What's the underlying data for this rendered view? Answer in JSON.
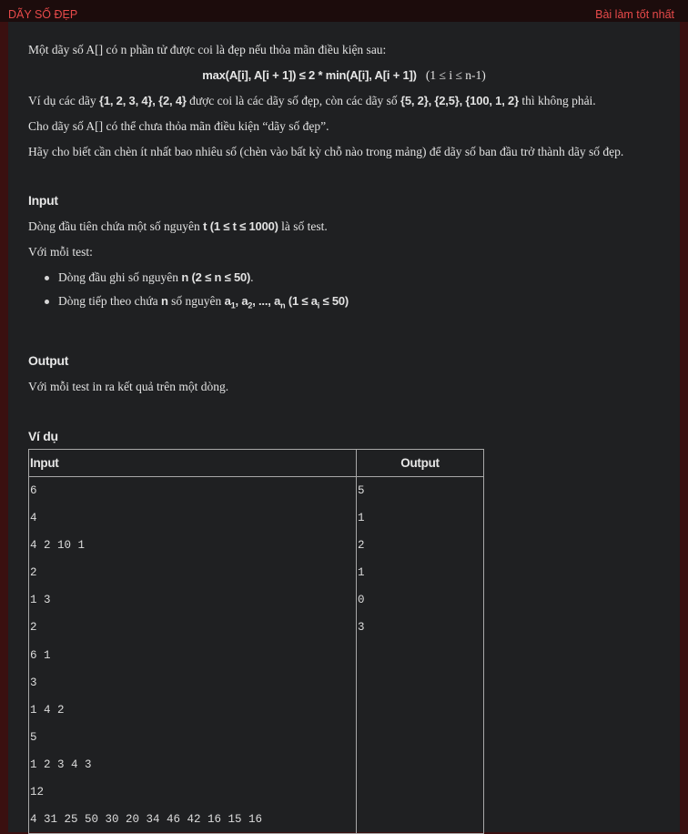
{
  "header": {
    "title": "DÃY SỐ ĐẸP",
    "right_label": "Bài làm tốt nhất"
  },
  "statement": {
    "p1": "Một dãy số A[] có n phần tử được coi là đẹp nếu thỏa mãn điều kiện sau:",
    "formula_main": "max(A[i], A[i + 1]) ≤ 2 * min(A[i], A[i + 1])",
    "formula_range": "(1 ≤ i ≤ n-1)",
    "p2_a": "Ví dụ các dãy ",
    "p2_good": "{1, 2, 3, 4}, {2, 4}",
    "p2_b": " được coi là các dãy số đẹp, còn các dãy số ",
    "p2_bad": "{5, 2}, {2,5}, {100, 1, 2}",
    "p2_c": " thì không phải.",
    "p3": "Cho dãy số A[] có thể chưa thỏa mãn điều kiện “dãy số đẹp”.",
    "p4": "Hãy cho biết cần chèn ít nhất bao nhiêu số (chèn vào bất kỳ chỗ nào trong mảng) để dãy số ban đầu trở thành dãy số đẹp."
  },
  "input_section": {
    "heading": "Input",
    "line1_a": "Dòng đầu tiên chứa một số nguyên ",
    "line1_b": "t (1 ≤ t ≤ 1000)",
    "line1_c": " là số test.",
    "line2": "Với mỗi test:",
    "bullet1_a": "Dòng đầu ghi số nguyên ",
    "bullet1_b": "n (2 ≤ n ≤ 50)",
    "bullet1_c": ".",
    "bullet2_a": "Dòng tiếp theo chứa ",
    "bullet2_n": "n",
    "bullet2_b": " số nguyên ",
    "bullet2_a1": "a",
    "bullet2_s1": "1",
    "bullet2_a2": ", a",
    "bullet2_s2": "2",
    "bullet2_an": ", ..., a",
    "bullet2_sn": "n",
    "bullet2_r1": " (1 ≤ a",
    "bullet2_si": "i",
    "bullet2_r2": " ≤ 50)"
  },
  "output_section": {
    "heading": "Output",
    "line1": "Với mỗi test in ra kết quả trên một dòng."
  },
  "example": {
    "heading": "Ví dụ",
    "input_header": "Input",
    "output_header": "Output",
    "input_lines": [
      "6",
      "4",
      "4 2 10 1",
      "2",
      "1 3",
      "2",
      "6 1",
      "3",
      "1 4 2",
      "5",
      "1 2 3 4 3",
      "12",
      "4 31 25 50 30 20 34 46 42 16 15 16"
    ],
    "output_lines": [
      "5",
      "1",
      "2",
      "1",
      "0",
      "3"
    ]
  }
}
